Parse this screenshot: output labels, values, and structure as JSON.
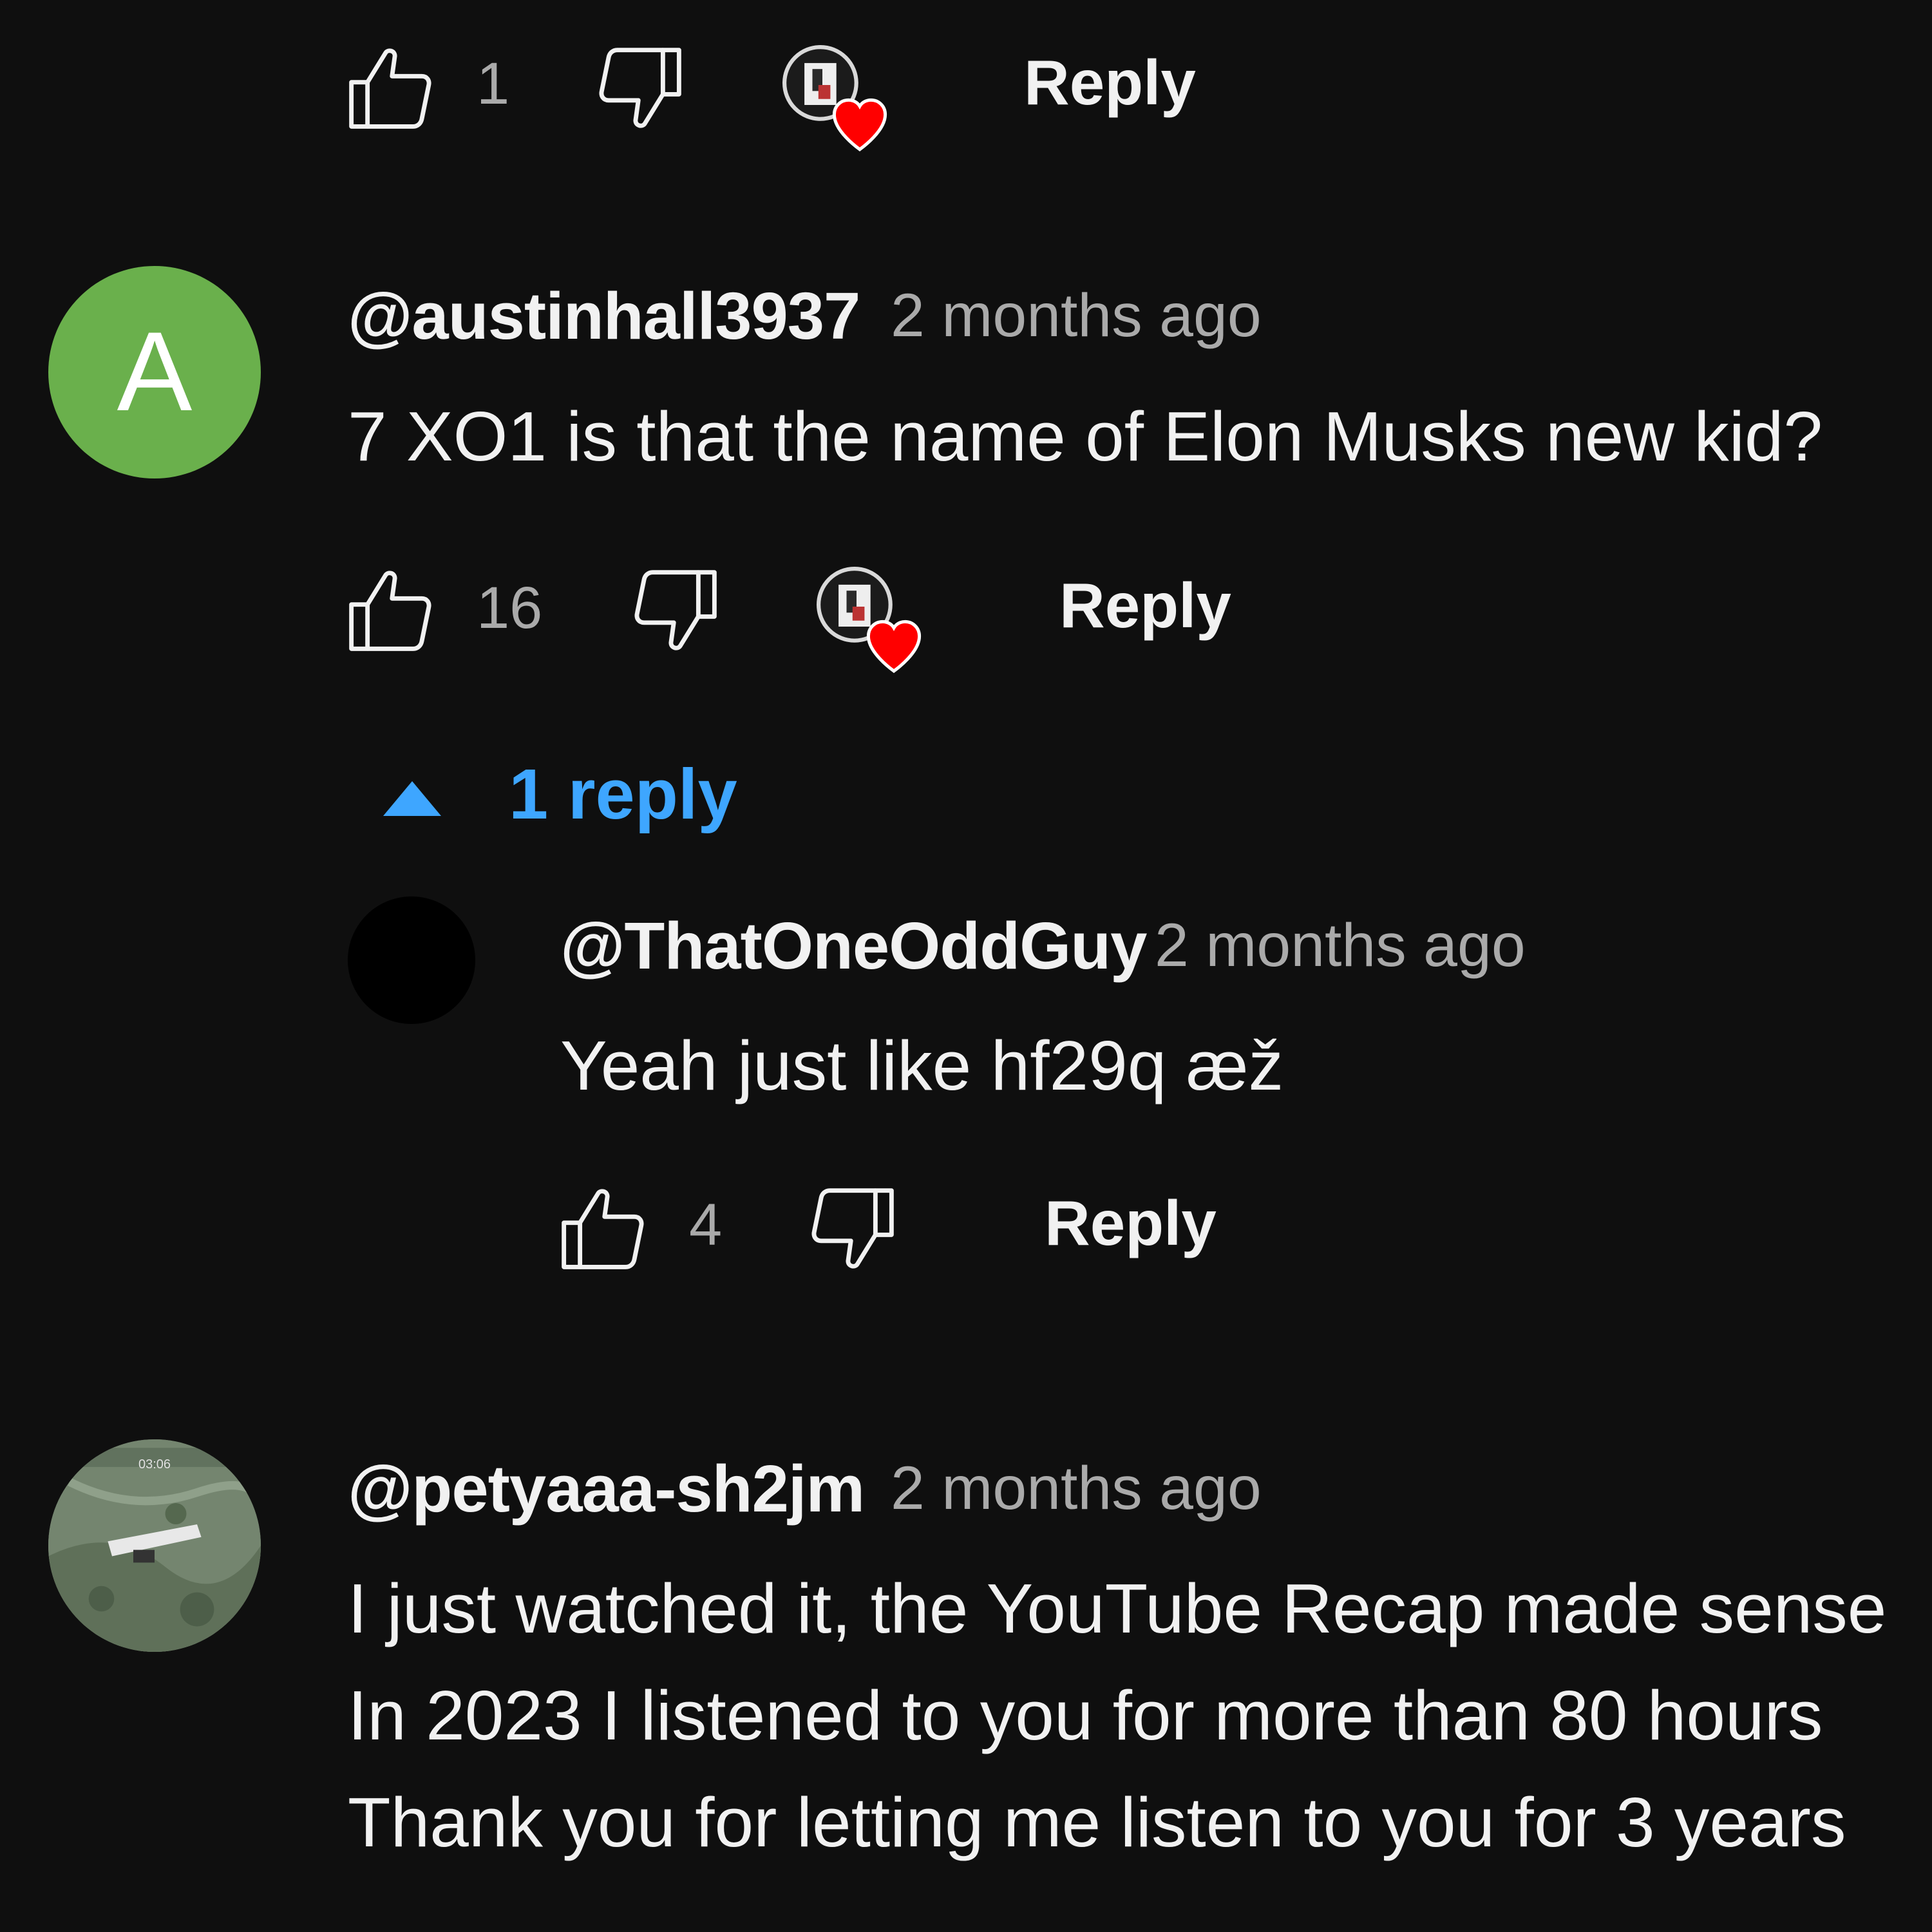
{
  "comments": [
    {
      "actions": {
        "like_count": "1",
        "reply_label": "Reply",
        "creator_heart": true
      }
    },
    {
      "author": "@austinhall3937",
      "time": "2 months ago",
      "avatar_letter": "A",
      "avatar_color": "#6ab04c",
      "text": "7 XO1 is that the name of Elon Musks new kid?",
      "actions": {
        "like_count": "16",
        "reply_label": "Reply",
        "creator_heart": true
      },
      "replies_toggle": {
        "label": "1 reply",
        "icon": "caret-up-icon"
      },
      "replies": [
        {
          "author": "@ThatOneOddGuy",
          "time": "2 months ago",
          "avatar_color": "#000000",
          "text": "Yeah just like hf29q æž",
          "actions": {
            "like_count": "4",
            "reply_label": "Reply"
          }
        }
      ]
    },
    {
      "author": "@petyaaa-sh2jm",
      "time": "2 months ago",
      "text_lines": [
        "I just watched it, the YouTube Recap made sense",
        "In 2023 I listened to you for more than 80 hours",
        "Thank you for letting me listen to you for 3 years"
      ],
      "avatar_thumbnail_text": {
        "timer": "03:06"
      }
    }
  ],
  "colors": {
    "background": "#0f0f0f",
    "text_primary": "#f1f1f1",
    "text_secondary": "#aaaaaa",
    "link_blue": "#3ea6ff",
    "heart_red": "#ff0000"
  }
}
